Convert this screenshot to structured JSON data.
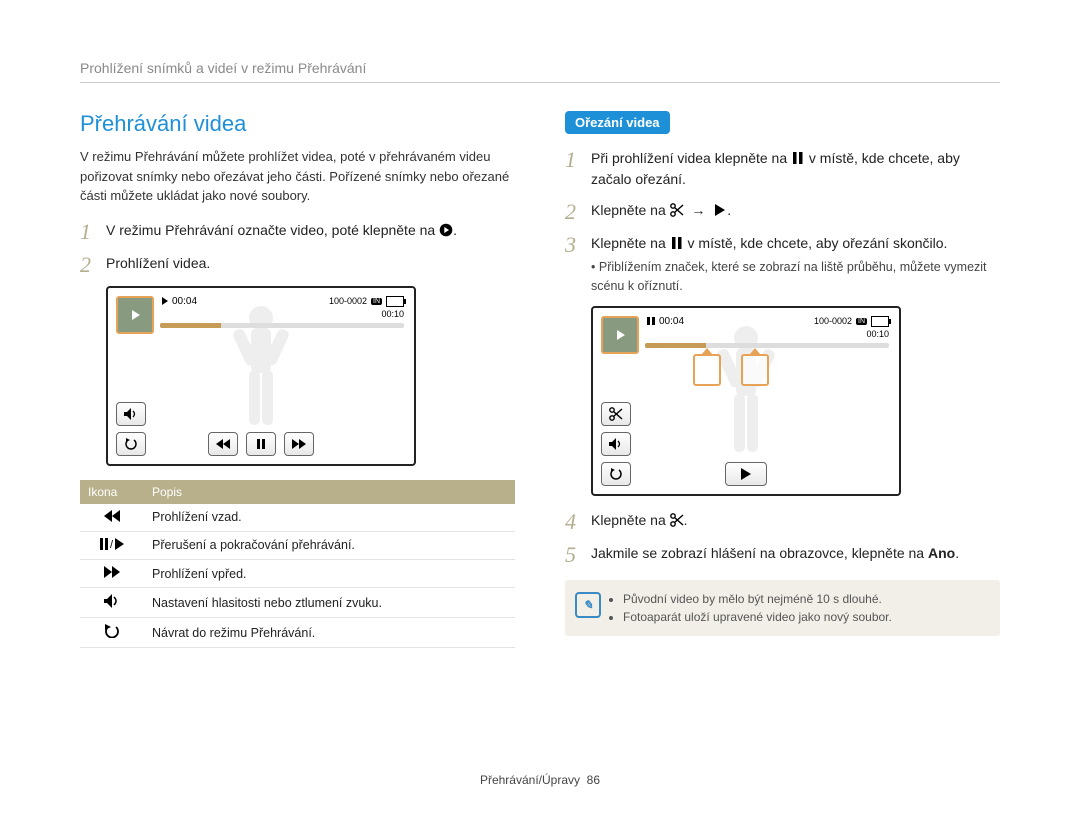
{
  "breadcrumb": "Prohlížení snímků a videí v režimu Přehrávání",
  "left": {
    "title": "Přehrávání videa",
    "intro": "V režimu Přehrávání můžete prohlížet videa, poté v přehrávaném videu pořizovat snímky nebo ořezávat jeho části. Pořízené snímky nebo ořezané části můžete ukládat jako nové soubory.",
    "step1": "V režimu Přehrávání označte video, poté klepněte na ",
    "step2": "Prohlížení videa.",
    "table": {
      "head_icon": "Ikona",
      "head_desc": "Popis",
      "r1": "Prohlížení vzad.",
      "r2": "Přerušení a pokračování přehrávání.",
      "r3": "Prohlížení vpřed.",
      "r4": "Nastavení hlasitosti nebo ztlumení zvuku.",
      "r5": "Návrat do režimu Přehrávání."
    }
  },
  "right": {
    "pill": "Ořezání videa",
    "step1": "Při prohlížení videa klepněte na",
    "step1b": "v místě, kde chcete, aby začalo ořezání.",
    "step2": "Klepněte na ",
    "step3a": "Klepněte na",
    "step3b": "v místě, kde chcete, aby ořezání skončilo.",
    "step3_sub": "Přiblížením značek, které se zobrazí na liště průběhu, můžete vymezit scénu k oříznutí.",
    "step4": "Klepněte na ",
    "step5a": "Jakmile se zobrazí hlášení na obrazovce, klepněte na ",
    "step5b": "Ano",
    "note1": "Původní video by mělo být nejméně 10 s dlouhé.",
    "note2": "Fotoaparát uloží upravené video jako nový soubor."
  },
  "player": {
    "time": "00:04",
    "file": "100-0002",
    "in": "IN",
    "total": "00:10"
  },
  "footer": {
    "section": "Přehrávání/Úpravy",
    "page": "86"
  }
}
